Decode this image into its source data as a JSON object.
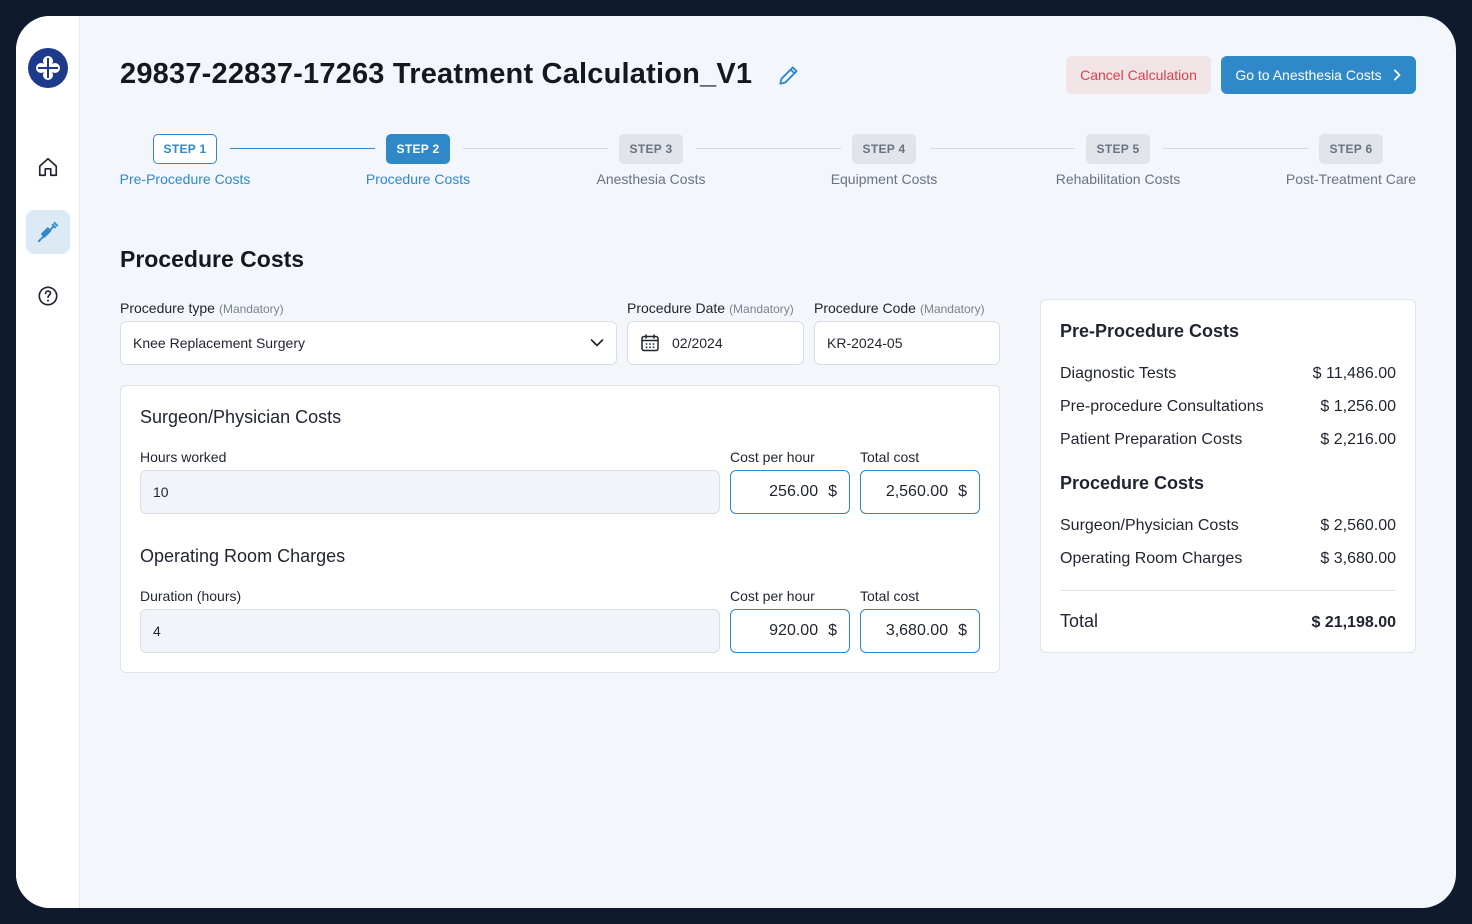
{
  "header": {
    "title": "29837-22837-17263 Treatment Calculation_V1",
    "cancel_label": "Cancel Calculation",
    "next_label": "Go to Anesthesia Costs"
  },
  "sidebar": {
    "items": [
      {
        "icon": "home-icon"
      },
      {
        "icon": "syringe-icon",
        "active": true
      },
      {
        "icon": "help-icon"
      }
    ]
  },
  "steps": [
    {
      "chip": "STEP 1",
      "label": "Pre-Procedure Costs",
      "state": "done"
    },
    {
      "chip": "STEP 2",
      "label": "Procedure Costs",
      "state": "current"
    },
    {
      "chip": "STEP 3",
      "label": "Anesthesia Costs",
      "state": "todo"
    },
    {
      "chip": "STEP 4",
      "label": "Equipment Costs",
      "state": "todo"
    },
    {
      "chip": "STEP 5",
      "label": "Rehabilitation Costs",
      "state": "todo"
    },
    {
      "chip": "STEP 6",
      "label": "Post-Treatment Care",
      "state": "todo"
    }
  ],
  "form": {
    "section_title": "Procedure Costs",
    "mandatory": "(Mandatory)",
    "procedure_type": {
      "label": "Procedure type",
      "value": "Knee Replacement Surgery"
    },
    "procedure_date": {
      "label": "Procedure Date",
      "value": "02/2024"
    },
    "procedure_code": {
      "label": "Procedure Code",
      "value": "KR-2024-05"
    }
  },
  "surgeon": {
    "title": "Surgeon/Physician Costs",
    "hours_label": "Hours worked",
    "hours_value": "10",
    "cph_label": "Cost per hour",
    "cph_value": "256.00",
    "total_label": "Total cost",
    "total_value": "2,560.00",
    "currency": "$"
  },
  "operating": {
    "title": "Operating Room Charges",
    "hours_label": "Duration (hours)",
    "hours_value": "4",
    "cph_label": "Cost per hour",
    "cph_value": "920.00",
    "total_label": "Total cost",
    "total_value": "3,680.00",
    "currency": "$"
  },
  "summary": {
    "pre_title": "Pre-Procedure Costs",
    "pre_rows": [
      {
        "label": "Diagnostic Tests",
        "value": "$ 11,486.00"
      },
      {
        "label": "Pre-procedure Consultations",
        "value": "$ 1,256.00"
      },
      {
        "label": "Patient Preparation Costs",
        "value": "$ 2,216.00"
      }
    ],
    "proc_title": "Procedure Costs",
    "proc_rows": [
      {
        "label": "Surgeon/Physician Costs",
        "value": "$ 2,560.00"
      },
      {
        "label": "Operating Room Charges",
        "value": "$ 3,680.00"
      }
    ],
    "total_label": "Total",
    "total_value": "$ 21,198.00"
  },
  "colors": {
    "accent": "#2f89c9",
    "danger": "#d9414f",
    "brand": "#1e3a8a"
  }
}
